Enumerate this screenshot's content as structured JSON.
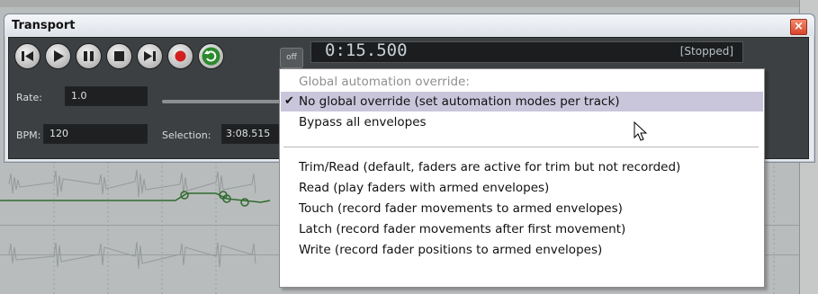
{
  "window": {
    "title": "Transport",
    "close_label": "×"
  },
  "transport": {
    "buttons": [
      {
        "name": "go-to-start",
        "icon": "skip-back-icon"
      },
      {
        "name": "play",
        "icon": "play-icon"
      },
      {
        "name": "pause",
        "icon": "pause-icon"
      },
      {
        "name": "stop",
        "icon": "stop-icon"
      },
      {
        "name": "go-to-end",
        "icon": "skip-forward-icon"
      },
      {
        "name": "record",
        "icon": "record-icon"
      },
      {
        "name": "repeat",
        "icon": "repeat-icon"
      }
    ],
    "override_label": "off",
    "time": "0:15.500",
    "status": "[Stopped]",
    "rate_label": "Rate:",
    "rate_value": "1.0",
    "bpm_label": "BPM:",
    "bpm_value": "120",
    "selection_label": "Selection:",
    "selection_value": "3:08.515"
  },
  "menu": {
    "header": "Global automation override:",
    "items": [
      {
        "label": "No global override (set automation modes per track)",
        "checked": true,
        "highlighted": true
      },
      {
        "label": "Bypass all envelopes",
        "checked": false
      },
      {
        "label": "Trim/Read (default, faders are active for trim but not recorded)",
        "checked": false
      },
      {
        "label": "Read (play faders with armed envelopes)",
        "checked": false
      },
      {
        "label": "Touch (record fader movements to armed envelopes)",
        "checked": false
      },
      {
        "label": "Latch (record fader movements after first movement)",
        "checked": false
      },
      {
        "label": "Write (record fader positions to armed envelopes)",
        "checked": false
      }
    ],
    "check_glyph": "✔"
  },
  "colors": {
    "menu_highlight": "#c9c6dc",
    "panel": "#3c4043",
    "envelope": "#2f6b2f",
    "waveform": "#8f9494"
  }
}
